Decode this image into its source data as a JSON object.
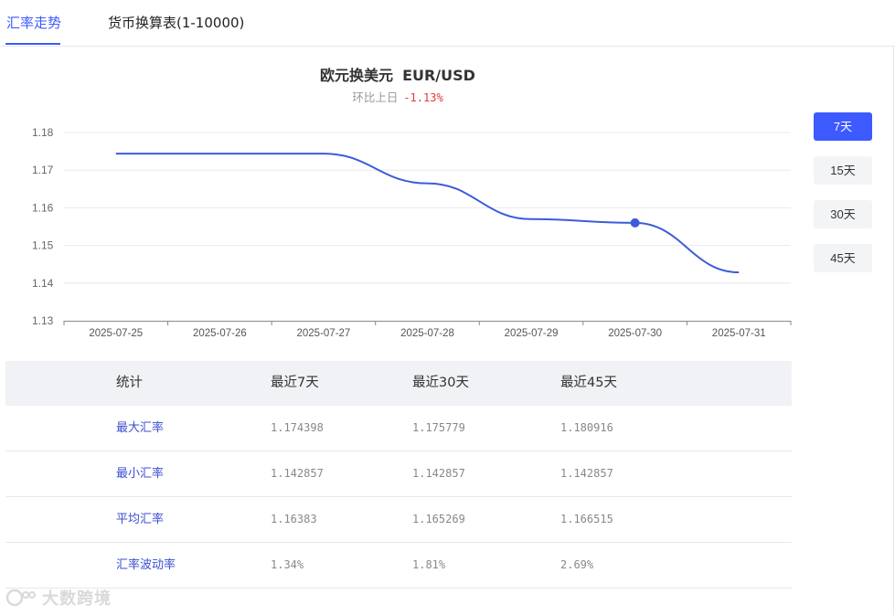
{
  "tabs": [
    {
      "label": "汇率走势",
      "active": true
    },
    {
      "label": "货币换算表(1-10000)",
      "active": false
    }
  ],
  "header": {
    "title": "欧元换美元",
    "pair": "EUR/USD",
    "change_label": "环比上日",
    "change_value": "-1.13%"
  },
  "periods": [
    "7天",
    "15天",
    "30天",
    "45天"
  ],
  "active_period": "7天",
  "colors": {
    "accent": "#3d5afe",
    "line": "#3b5bdb",
    "negative": "#e4393c"
  },
  "chart_data": {
    "type": "line",
    "title": "",
    "xlabel": "",
    "ylabel": "",
    "x": [
      "2025-07-25",
      "2025-07-26",
      "2025-07-27",
      "2025-07-28",
      "2025-07-29",
      "2025-07-30",
      "2025-07-31"
    ],
    "series": [
      {
        "name": "",
        "values": [
          1.174398,
          1.174398,
          1.174398,
          1.1665,
          1.157,
          1.156,
          1.142857
        ]
      }
    ],
    "highlighted_point": {
      "x": "2025-07-30",
      "y": 1.156
    },
    "ylim": [
      1.13,
      1.18
    ],
    "yticks": [
      "1.13",
      "1.14",
      "1.15",
      "1.16",
      "1.17",
      "1.18"
    ],
    "grid": true
  },
  "stats": {
    "headers": [
      "统计",
      "最近7天",
      "最近30天",
      "最近45天"
    ],
    "rows": [
      {
        "label": "最大汇率",
        "values": [
          "1.174398",
          "1.175779",
          "1.180916"
        ]
      },
      {
        "label": "最小汇率",
        "values": [
          "1.142857",
          "1.142857",
          "1.142857"
        ]
      },
      {
        "label": "平均汇率",
        "values": [
          "1.16383",
          "1.165269",
          "1.166515"
        ]
      },
      {
        "label": "汇率波动率",
        "values": [
          "1.34%",
          "1.81%",
          "2.69%"
        ]
      }
    ]
  },
  "watermark": {
    "text": "大数跨境",
    "icon": "brand-logo-icon"
  }
}
